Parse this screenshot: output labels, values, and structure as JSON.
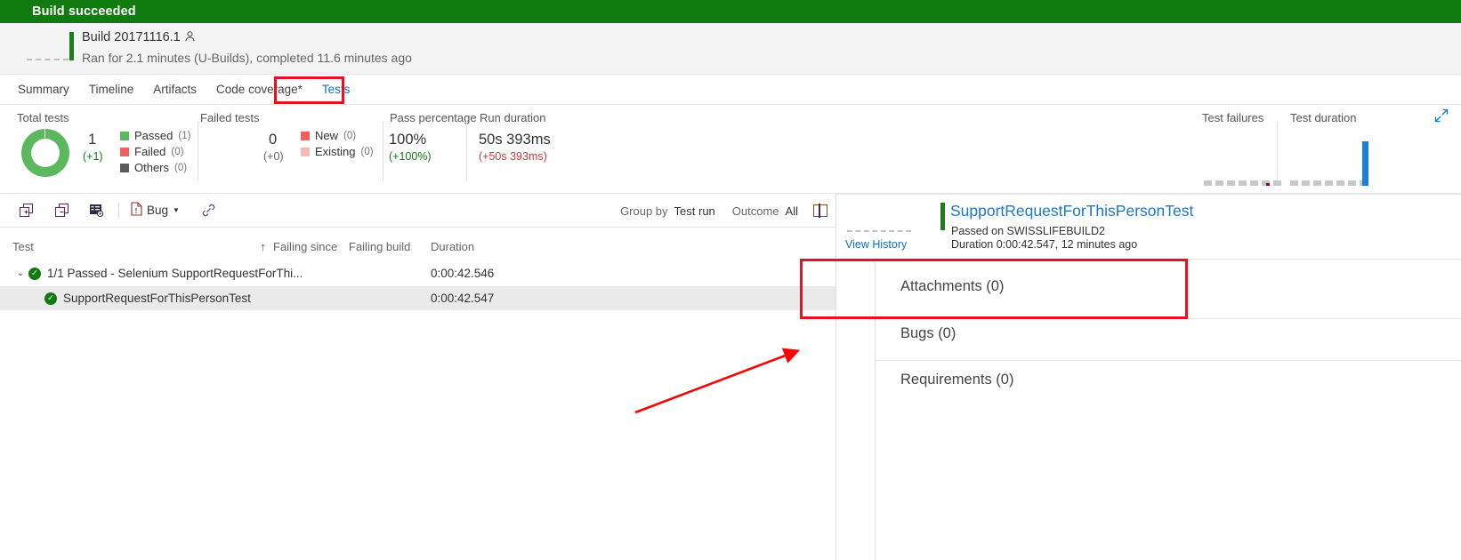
{
  "status": {
    "text": "Build succeeded",
    "bar_color": "#107c10"
  },
  "build": {
    "title": "Build 20171116.1",
    "owner_icon": "person-icon",
    "subtitle": "Ran for 2.1 minutes (U-Builds), completed 11.6 minutes ago"
  },
  "tabs": [
    {
      "label": "Summary",
      "selected": false
    },
    {
      "label": "Timeline",
      "selected": false
    },
    {
      "label": "Artifacts",
      "selected": false
    },
    {
      "label": "Code coverage*",
      "selected": false
    },
    {
      "label": "Tests",
      "selected": true
    }
  ],
  "summary": {
    "total_tests": {
      "label": "Total tests",
      "value": "1",
      "delta": "(+1)",
      "legend": [
        {
          "label": "Passed",
          "count": "(1)",
          "color": "#5cb85c"
        },
        {
          "label": "Failed",
          "count": "(0)",
          "color": "#f25f5c"
        },
        {
          "label": "Others",
          "count": "(0)",
          "color": "#5a5a5a"
        }
      ]
    },
    "failed_tests": {
      "label": "Failed tests",
      "value": "0",
      "delta": "(+0)",
      "legend": [
        {
          "label": "New",
          "count": "(0)",
          "color": "#f25f5c"
        },
        {
          "label": "Existing",
          "count": "(0)",
          "color": "#f7b8b6"
        }
      ]
    },
    "pass_percentage": {
      "label": "Pass percentage",
      "value": "100%",
      "delta": "(+100%)"
    },
    "run_duration": {
      "label": "Run duration",
      "value": "50s 393ms",
      "delta": "(+50s 393ms)"
    },
    "test_failures": {
      "label": "Test failures",
      "spark_color": "#a80000"
    },
    "test_duration": {
      "label": "Test duration",
      "spark_color": "#1a7fdd"
    },
    "expand_icon": "expand-diagonal-icon"
  },
  "toolbar": {
    "icons": [
      {
        "name": "expand-all-icon"
      },
      {
        "name": "collapse-all-icon"
      },
      {
        "name": "test-settings-icon"
      }
    ],
    "bug_label": "Bug",
    "bug_icon": "bug-file-icon",
    "link_icon": "link-icon",
    "group_by_label": "Group by",
    "group_by_value": "Test run",
    "outcome_label": "Outcome",
    "outcome_value": "All",
    "split_pane_icon": "split-pane-icon"
  },
  "grid": {
    "columns": [
      "Test",
      "Failing since",
      "Failing build",
      "Duration"
    ],
    "sort_indicator": "↑",
    "rows": [
      {
        "type": "group",
        "title": "1/1 Passed - Selenium SupportRequestForThi...",
        "failing_since": "",
        "failing_build": "",
        "duration": "0:00:42.546",
        "expanded": true,
        "selected": false,
        "status": "passed"
      },
      {
        "type": "test",
        "title": "SupportRequestForThisPersonTest",
        "failing_since": "",
        "failing_build": "",
        "duration": "0:00:42.547",
        "expanded": false,
        "selected": true,
        "status": "passed"
      }
    ]
  },
  "detail": {
    "view_history": "View History",
    "title": "SupportRequestForThisPersonTest",
    "line1": "Passed on SWISSLIFEBUILD2",
    "line2": "Duration 0:00:42.547, 12 minutes ago",
    "sections": [
      {
        "label": "Attachments (0)"
      },
      {
        "label": "Bugs (0)"
      },
      {
        "label": "Requirements (0)"
      }
    ]
  },
  "annotations": {
    "highlight_color": "#e81123",
    "tests_tab_box": "Tests",
    "attachments_box": "Attachments (0)",
    "arrow": "points-to-attachments"
  }
}
